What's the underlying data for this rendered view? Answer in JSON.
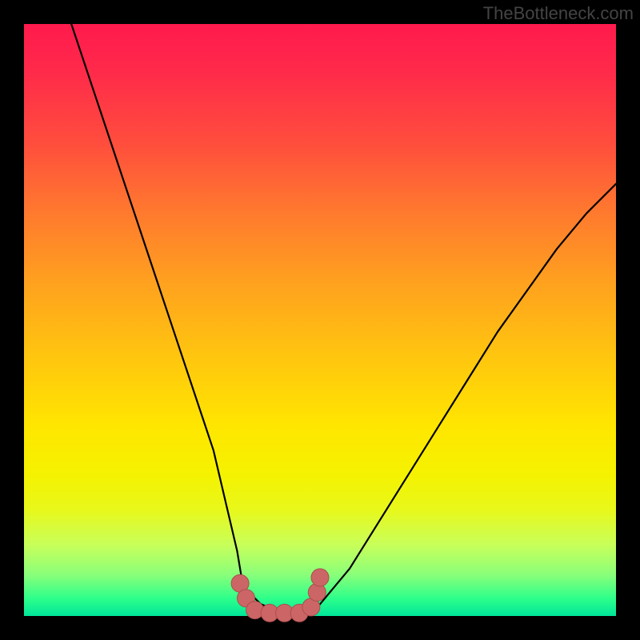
{
  "attribution": "TheBottleneck.com",
  "colors": {
    "page_bg": "#000000",
    "gradient_top": "#ff1a4d",
    "gradient_bottom": "#00e69a",
    "curve": "#000000",
    "marker_fill": "#cc6666",
    "marker_stroke": "#aa4d4d"
  },
  "chart_data": {
    "type": "line",
    "title": "",
    "xlabel": "",
    "ylabel": "",
    "xlim": [
      0,
      100
    ],
    "ylim": [
      0,
      100
    ],
    "grid": false,
    "note": "V-shaped bottleneck curve over heatmap gradient. Values are approximate percentages read from curve shape (no axis ticks present). y=0 is best (green), y=100 is worst (red).",
    "series": [
      {
        "name": "bottleneck-curve",
        "x": [
          8,
          12,
          16,
          20,
          24,
          28,
          32,
          36,
          37,
          40,
          45,
          48,
          50,
          55,
          60,
          65,
          70,
          75,
          80,
          85,
          90,
          95,
          100
        ],
        "y": [
          100,
          88,
          76,
          64,
          52,
          40,
          28,
          11,
          5,
          2,
          0,
          0,
          2,
          8,
          16,
          24,
          32,
          40,
          48,
          55,
          62,
          68,
          73
        ]
      }
    ],
    "markers": {
      "name": "optimal-zone",
      "note": "Cluster of round markers at the curve minimum (green band).",
      "points": [
        {
          "x": 36.5,
          "y": 5.5
        },
        {
          "x": 37.5,
          "y": 3.0
        },
        {
          "x": 39.0,
          "y": 1.0
        },
        {
          "x": 41.5,
          "y": 0.5
        },
        {
          "x": 44.0,
          "y": 0.5
        },
        {
          "x": 46.5,
          "y": 0.5
        },
        {
          "x": 48.5,
          "y": 1.5
        },
        {
          "x": 49.5,
          "y": 4.0
        },
        {
          "x": 50.0,
          "y": 6.5
        }
      ]
    }
  }
}
